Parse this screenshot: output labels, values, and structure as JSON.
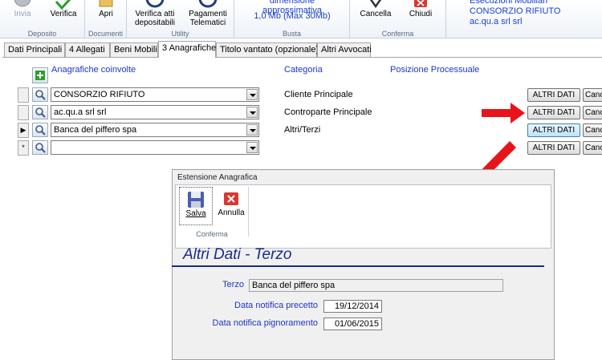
{
  "ribbon": {
    "deposito": {
      "label": "Deposito",
      "invia": "Invia",
      "verifica": "Verifica"
    },
    "documenti": {
      "label": "Documenti",
      "apri": "Apri"
    },
    "utility": {
      "label": "Utility",
      "verifica_atti": "Verifica atti depositabili",
      "pagamenti": "Pagamenti Telematici"
    },
    "busta": {
      "label": "Busta",
      "dimensione": "dimensione approssimativa",
      "size": "1,0 Mb (Max 30Mb)"
    },
    "conferma": {
      "label": "Conferma",
      "cancella": "Cancella",
      "chiudi": "Chiudi"
    },
    "info": {
      "line1": "Esecuzioni Mobiliari",
      "line2": "CONSORZIO RIFIUTO",
      "line3": "ac.qu.a srl srl"
    }
  },
  "tabs": [
    "Dati Principali",
    "4 Allegati",
    "Beni Mobili",
    "3 Anagrafiche",
    "Titolo vantato (opzionale)",
    "Altri Avvocati"
  ],
  "grid": {
    "headers": {
      "anagrafiche": "Anagrafiche coinvolte",
      "categoria": "Categoria",
      "posizione": "Posizione Processuale"
    },
    "rows": [
      {
        "name": "CONSORZIO RIFIUTO",
        "category": "Cliente Principale",
        "marker": ""
      },
      {
        "name": "ac.qu.a srl srl",
        "category": "Controparte Principale",
        "marker": ""
      },
      {
        "name": "Banca del piffero spa",
        "category": "Altri/Terzi",
        "marker": "▶"
      },
      {
        "name": "",
        "category": "",
        "marker": "*"
      }
    ],
    "altri_dati": "ALTRI DATI",
    "cancella_short": "Canc"
  },
  "dialog": {
    "title": "Estensione Anagrafica",
    "salva": "Salva",
    "annulla": "Annulla",
    "group_label": "Conferma",
    "heading": "Altri Dati - Terzo",
    "terzo_label": "Terzo",
    "terzo_value": "Banca del piffero spa",
    "notifica_precetto_label": "Data notifica precetto",
    "notifica_precetto_value": "19/12/2014",
    "notifica_pignoramento_label": "Data notifica pignoramento",
    "notifica_pignoramento_value": "01/06/2015"
  },
  "colors": {
    "accent_blue": "#1d35c8",
    "arrow_red": "#e8141b",
    "heading_navy": "#1b2a8a"
  },
  "icons": [
    "add-icon",
    "search-icon",
    "dropdown-arrow-icon",
    "save-icon",
    "cancel-icon",
    "row-indicator-icon"
  ]
}
